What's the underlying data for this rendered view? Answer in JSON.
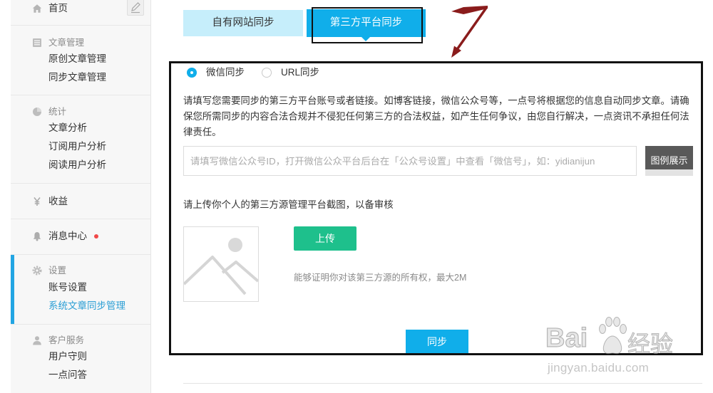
{
  "colors": {
    "accent": "#10aeea",
    "tab_inactive_bg": "#c6eefb",
    "upload_green": "#1ec08c",
    "active_link": "#2c9fd5",
    "active_bar": "#22a5e3",
    "badge": "#f04848",
    "annotation": "#111111",
    "arrow": "#8a1c1c"
  },
  "sidebar": {
    "home": {
      "label": "首页",
      "icon": "home-icon",
      "action_icon": "edit-icon"
    },
    "groups": [
      {
        "title": "文章管理",
        "icon": "document-icon",
        "items": [
          "原创文章管理",
          "同步文章管理"
        ]
      },
      {
        "title": "统计",
        "icon": "statistics-icon",
        "items": [
          "文章分析",
          "订阅用户分析",
          "阅读用户分析"
        ]
      },
      {
        "title": "收益",
        "icon": "yen-icon",
        "items": []
      },
      {
        "title": "消息中心",
        "icon": "bell-icon",
        "unread_dot": true,
        "items": []
      },
      {
        "title": "设置",
        "icon": "gear-icon",
        "active_group": true,
        "items": [
          "账号设置",
          "系统文章同步管理"
        ],
        "selected_item_index": 1
      },
      {
        "title": "客户服务",
        "icon": "user-icon",
        "items": [
          "用户守则",
          "一点问答"
        ]
      }
    ]
  },
  "tabs": [
    {
      "label": "自有网站同步",
      "active": false
    },
    {
      "label": "第三方平台同步",
      "active": true
    }
  ],
  "sync_form": {
    "radios": [
      {
        "label": "微信同步",
        "checked": true
      },
      {
        "label": "URL同步",
        "checked": false
      }
    ],
    "notice": "请填写您需要同步的第三方平台账号或者链接。如博客链接，微信公众号等，一点号将根据您的信息自动同步文章。请确保您所需同步的内容合法合规并不侵犯任何第三方的合法权益，如产生任何争议，由您自行解决，一点资讯不承担任何法律责任。",
    "input_placeholder": "请填写微信公众号ID，打开微信公众平台后台在「公众号设置」中查看「微信号」，如：yidianijun",
    "example_button": "图例展示",
    "upload_prompt": "请上传你个人的第三方源管理平台截图，以备审核",
    "upload_preview_icon": "image-placeholder-icon",
    "upload_button": "上传",
    "upload_hint": "能够证明你对该第三方源的所有权，最大2M",
    "submit_button": "同步"
  },
  "watermark": {
    "brand_latin": "Bai",
    "brand_cn": "经验",
    "url": "jingyan.baidu.com"
  }
}
